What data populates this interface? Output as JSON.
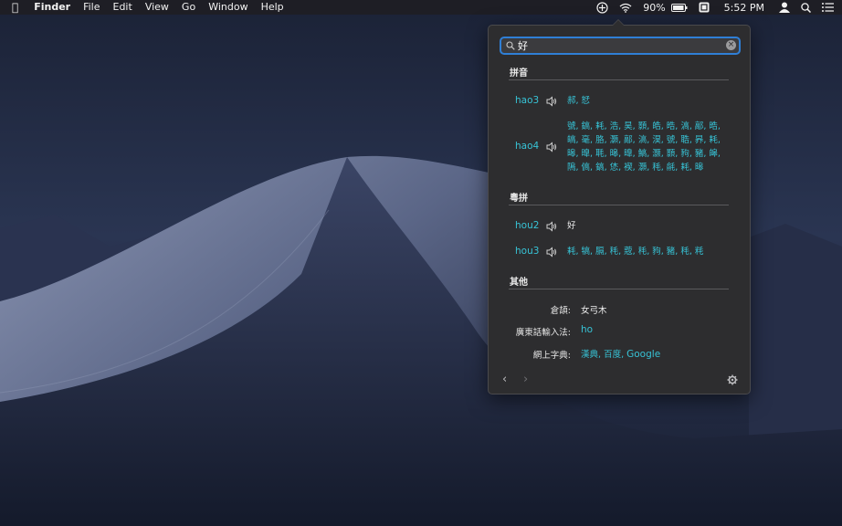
{
  "colors": {
    "accent": "#37c3d6",
    "focus": "#2f7fd6",
    "panel": "#2d2d2f"
  },
  "menubar": {
    "apple_icon": "apple-icon",
    "app_name": "Finder",
    "menus": [
      "File",
      "Edit",
      "View",
      "Go",
      "Window",
      "Help"
    ],
    "battery": "90%",
    "clock": "5:52 PM"
  },
  "search": {
    "value": "好"
  },
  "pinyin": {
    "title": "拼音",
    "rows": [
      {
        "rom": "hao3",
        "chars": "郝, 恏"
      },
      {
        "rom": "hao4",
        "chars": "號, 鎬, 耗, 浩, 昊, 顥, 皓, 晧, 滈, 鄗, 晧, 皜, 毫, 胳, 灝, 鄗, 滈, 淏, 號, 聕, 昦, 耗, 暤, 曍, 毦, 暤, 曍, 鰝, 灏, 顥, 豞, 豬, 皞, 隝, 傐, 鎬, 恷, 褉, 灝, 秏, 毹, 耗, 暤"
      }
    ]
  },
  "jyutping": {
    "title": "粵拼",
    "rows": [
      {
        "rom": "hou2",
        "chars": "好"
      },
      {
        "rom": "hou3",
        "chars": "耗, 犒, 膈, 秏, 蔲, 秏, 豞, 豬, 秏, 粍"
      }
    ]
  },
  "other": {
    "title": "其他",
    "cangjie_label": "倉頡:",
    "cangjie_value": "女弓木",
    "cantonese_label": "廣東話輸入法:",
    "cantonese_value": "ho",
    "dict_label": "網上字典:",
    "dict_links": [
      "漢典",
      "百度",
      "Google"
    ]
  },
  "footer": {
    "back": "‹",
    "forward": "›"
  }
}
